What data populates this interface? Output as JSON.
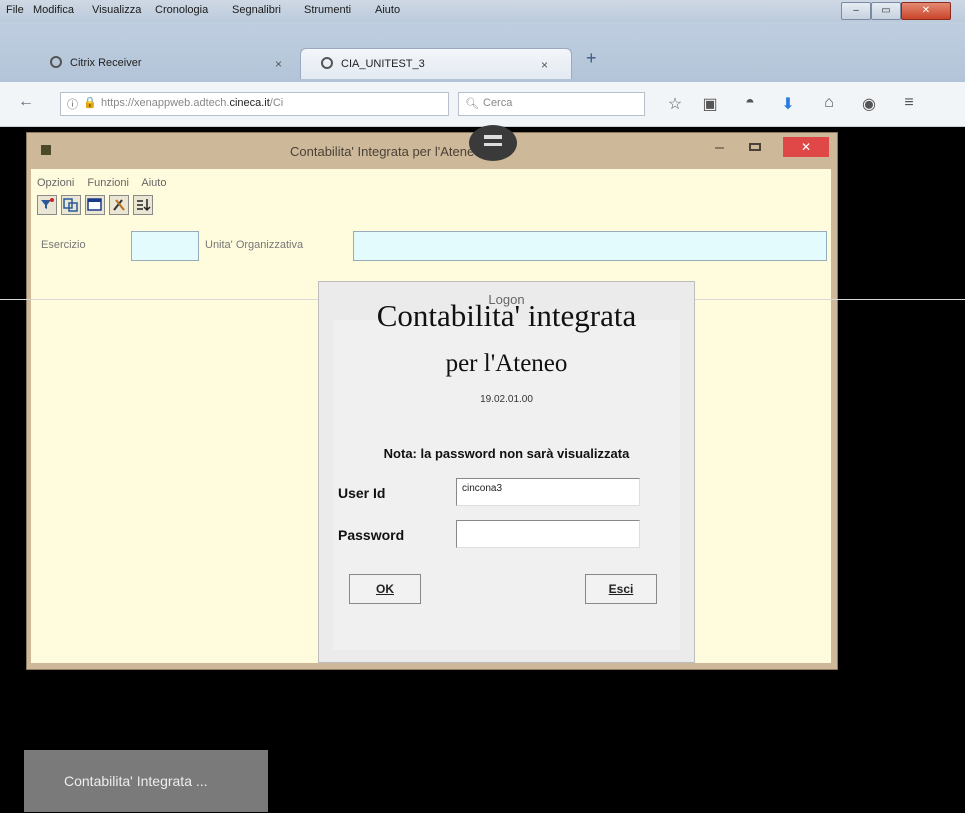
{
  "browser": {
    "menu": [
      "File",
      "Modifica",
      "Visualizza",
      "Cronologia",
      "Segnalibri",
      "Strumenti",
      "Aiuto"
    ],
    "tabs": [
      {
        "label": "Citrix Receiver",
        "icon": "citrix-icon"
      },
      {
        "label": "CIA_UNITEST_3",
        "icon": "citrix-icon",
        "active": true
      }
    ],
    "url_prefix": "https://xenappweb.adtech.",
    "url_domain": "cineca.it",
    "url_suffix": "/Ci",
    "search_placeholder": "Cerca"
  },
  "app": {
    "title": "Contabilita' Integrata per l'Ateneo",
    "menu": [
      "Opzioni",
      "Funzioni",
      "Aiuto"
    ],
    "toolbar_icons": [
      "filter-icon",
      "copy-icon",
      "window-icon",
      "tools-icon",
      "sort-icon"
    ],
    "fields": {
      "esercizio_label": "Esercizio",
      "unita_label": "Unita' Organizzativa"
    }
  },
  "logon": {
    "title": "Logon",
    "heading": "Contabilita' integrata",
    "subheading": "per l'Ateneo",
    "version": "19.02.01.00",
    "note": "Nota: la password non sarà visualizzata",
    "user_label": "User Id",
    "user_value": "cincona3",
    "password_label": "Password",
    "ok_label": "OK",
    "esci_label": "Esci"
  },
  "taskbar": {
    "item_label": "Contabilita' Integrata ..."
  },
  "colors": {
    "app_frame": "#cdb899",
    "app_body": "#fffbdd",
    "input_bg": "#e4fbfd",
    "close_red": "#e04848"
  }
}
